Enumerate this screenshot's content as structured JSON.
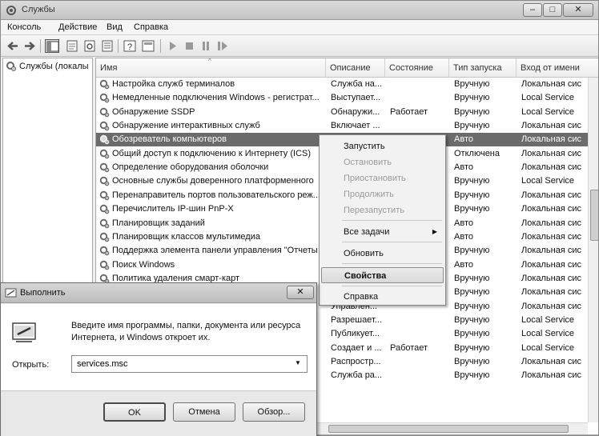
{
  "window": {
    "title": "Службы",
    "buttons": {
      "minimize": "–",
      "maximize": "□",
      "close": "✕"
    }
  },
  "menubar": [
    "Консоль",
    "Действие",
    "Вид",
    "Справка"
  ],
  "tree": {
    "root": "Службы (локалы"
  },
  "list": {
    "columns": [
      "Имя",
      "Описание",
      "Состояние",
      "Тип запуска",
      "Вход от имени"
    ],
    "rows": [
      {
        "name": "Настройка служб терминалов",
        "desc": "Служба на...",
        "state": "",
        "start": "Вручную",
        "logon": "Локальная сис"
      },
      {
        "name": "Немедленные подключения Windows - регистрат...",
        "desc": "Выступает...",
        "state": "",
        "start": "Вручную",
        "logon": "Local Service"
      },
      {
        "name": "Обнаружение SSDP",
        "desc": "Обнаружи...",
        "state": "Работает",
        "start": "Вручную",
        "logon": "Local Service"
      },
      {
        "name": "Обнаружение интерактивных служб",
        "desc": "Включает ...",
        "state": "",
        "start": "Вручную",
        "logon": "Локальная сис"
      },
      {
        "name": "Обозреватель компьютеров",
        "desc": "",
        "state": "",
        "start": "Авто",
        "logon": "Локальная сис",
        "selected": true
      },
      {
        "name": "Общий доступ к подключению к Интернету (ICS)",
        "desc": "",
        "state": "",
        "start": "Отключена",
        "logon": "Локальная сис"
      },
      {
        "name": "Определение оборудования оболочки",
        "desc": "",
        "state": "",
        "start": "Авто",
        "logon": "Локальная сис"
      },
      {
        "name": "Основные службы доверенного платформенного",
        "desc": "",
        "state": "",
        "start": "Вручную",
        "logon": "Local Service"
      },
      {
        "name": "Перенаправитель портов пользовательского реж...",
        "desc": "",
        "state": "",
        "start": "Вручную",
        "logon": "Локальная сис"
      },
      {
        "name": "Перечислитель IP-шин PnP-X",
        "desc": "",
        "state": "",
        "start": "Вручную",
        "logon": "Локальная сис"
      },
      {
        "name": "Планировщик заданий",
        "desc": "",
        "state": "",
        "start": "Авто",
        "logon": "Локальная сис"
      },
      {
        "name": "Планировщик классов мультимедиа",
        "desc": "",
        "state": "",
        "start": "Авто",
        "logon": "Локальная сис"
      },
      {
        "name": "Поддержка элемента панели управления \"Отчеты",
        "desc": "",
        "state": "",
        "start": "Вручную",
        "logon": "Локальная сис"
      },
      {
        "name": "Поиск Windows",
        "desc": "",
        "state": "",
        "start": "Авто",
        "logon": "Локальная сис"
      },
      {
        "name": "Политика удаления смарт-карт",
        "desc": "",
        "state": "",
        "start": "Вручную",
        "logon": "Локальная сис"
      },
      {
        "name": "",
        "desc": "",
        "state": "",
        "start": "Вручную",
        "logon": "Локальная сис"
      },
      {
        "name": "",
        "desc": "Управлен...",
        "state": "",
        "start": "Вручную",
        "logon": "Локальная сис"
      },
      {
        "name": "",
        "desc": "Разрешает...",
        "state": "",
        "start": "Вручную",
        "logon": "Local Service"
      },
      {
        "name": "",
        "desc": "Публикует...",
        "state": "",
        "start": "Вручную",
        "logon": "Local Service"
      },
      {
        "name": "",
        "desc": "Создает и ...",
        "state": "Работает",
        "start": "Вручную",
        "logon": "Local Service"
      },
      {
        "name": "",
        "desc": "Распростр...",
        "state": "",
        "start": "Вручную",
        "logon": "Локальная сис"
      },
      {
        "name": "",
        "desc": "Служба ра...",
        "state": "",
        "start": "Вручную",
        "logon": "Локальная сис"
      }
    ]
  },
  "context_menu": {
    "items": [
      {
        "label": "Запустить",
        "disabled": false
      },
      {
        "label": "Остановить",
        "disabled": true
      },
      {
        "label": "Приостановить",
        "disabled": true
      },
      {
        "label": "Продолжить",
        "disabled": true
      },
      {
        "label": "Перезапустить",
        "disabled": true
      },
      {
        "label": "Все задачи",
        "disabled": false,
        "submenu": true
      },
      {
        "label": "Обновить",
        "disabled": false
      },
      {
        "label": "Свойства",
        "disabled": false,
        "bold": true,
        "highlighted": true
      },
      {
        "label": "Справка",
        "disabled": false
      }
    ]
  },
  "run_dialog": {
    "title": "Выполнить",
    "close": "✕",
    "description": "Введите имя программы, папки, документа или ресурса Интернета, и Windows откроет их.",
    "open_label": "Открыть:",
    "input_value": "services.msc",
    "ok": "OK",
    "cancel": "Отмена",
    "browse": "Обзор..."
  },
  "icons": {
    "app": "services-icon",
    "back": "back-arrow-icon",
    "forward": "forward-arrow-icon",
    "console_tree": "console-tree-icon",
    "properties": "properties-icon",
    "refresh": "refresh-icon",
    "export": "export-list-icon",
    "help": "help-icon",
    "start": "play-icon",
    "stop": "stop-icon",
    "pause": "pause-icon",
    "restart": "restart-icon",
    "service": "gear-icon",
    "run": "run-icon"
  }
}
